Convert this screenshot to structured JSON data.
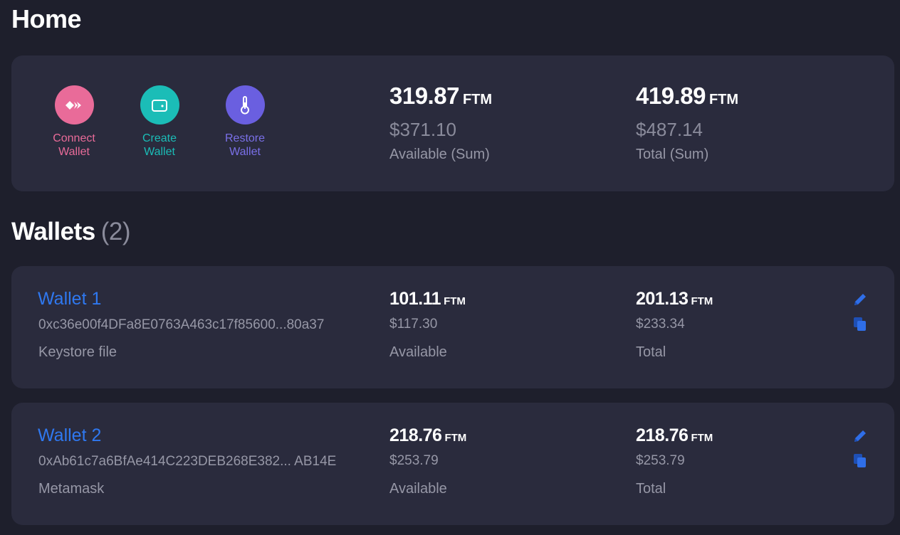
{
  "page": {
    "title": "Home"
  },
  "actions": {
    "connect": {
      "line1": "Connect",
      "line2": "Wallet",
      "icon": "diamond-arrows-icon",
      "color": "#e96b99"
    },
    "create": {
      "line1": "Create",
      "line2": "Wallet",
      "icon": "wallet-icon",
      "color": "#1bbdb7"
    },
    "restore": {
      "line1": "Restore",
      "line2": "Wallet",
      "icon": "thermometer-icon",
      "color": "#6a5fe0"
    }
  },
  "summary": {
    "available": {
      "amount": "319.87",
      "unit": "FTM",
      "usd": "$371.10",
      "label": "Available (Sum)"
    },
    "total": {
      "amount": "419.89",
      "unit": "FTM",
      "usd": "$487.14",
      "label": "Total (Sum)"
    }
  },
  "wallets_section": {
    "title": "Wallets",
    "count": "(2)"
  },
  "wallets": [
    {
      "name": "Wallet 1",
      "address": "0xc36e00f4DFa8E0763A463c17f85600...80a37",
      "type": "Keystore file",
      "available": {
        "amount": "101.11",
        "unit": "FTM",
        "usd": "$117.30",
        "label": "Available"
      },
      "total": {
        "amount": "201.13",
        "unit": "FTM",
        "usd": "$233.34",
        "label": "Total"
      }
    },
    {
      "name": "Wallet 2",
      "address": "0xAb61c7a6BfAe414C223DEB268E382... AB14E",
      "type": "Metamask",
      "available": {
        "amount": "218.76",
        "unit": "FTM",
        "usd": "$253.79",
        "label": "Available"
      },
      "total": {
        "amount": "218.76",
        "unit": "FTM",
        "usd": "$253.79",
        "label": "Total"
      }
    }
  ],
  "icons": {
    "edit": "pencil-icon",
    "copy": "copy-icon"
  },
  "colors": {
    "accent": "#2f78f0",
    "background": "#1e1f2c",
    "card": "#2a2b3d"
  }
}
